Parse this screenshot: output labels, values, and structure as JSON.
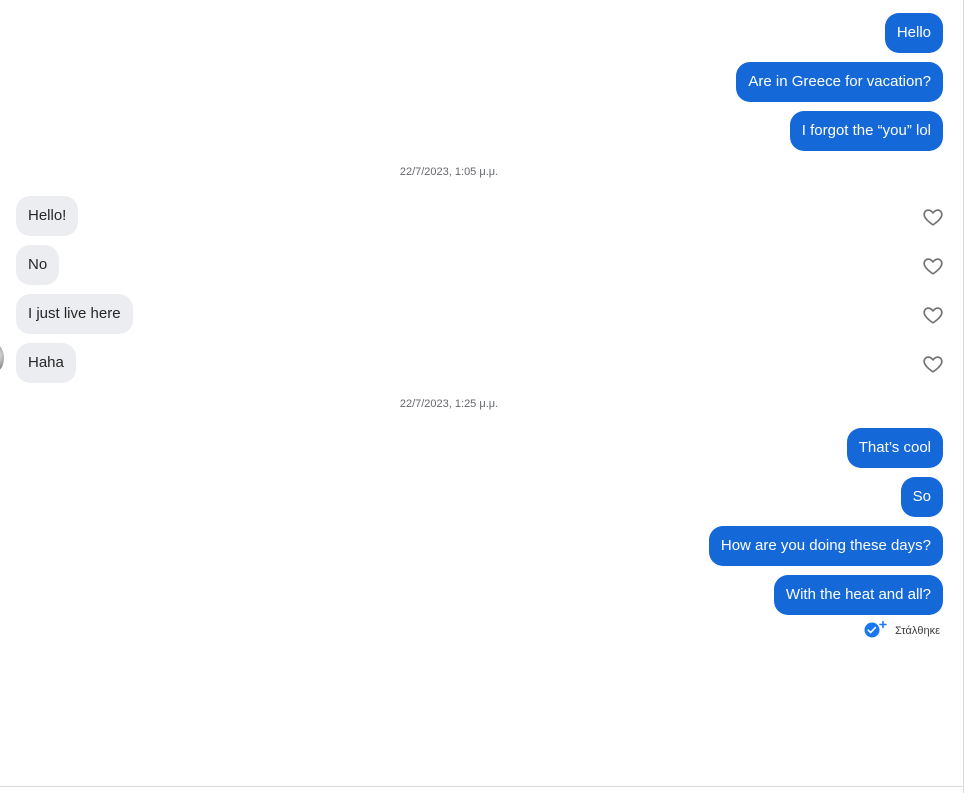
{
  "conversation": {
    "group1": {
      "messages": [
        "Hello",
        "Are in Greece for vacation?",
        "I forgot the “you” lol"
      ]
    },
    "timestamp1": "22/7/2023, 1:05 μ.μ.",
    "group2": {
      "messages": [
        "Hello!",
        "No",
        "I just live here",
        "Haha"
      ]
    },
    "timestamp2": "22/7/2023, 1:25 μ.μ.",
    "group3": {
      "messages": [
        "That’s cool",
        "So",
        "How are you doing these days?",
        "With the heat and all?"
      ]
    },
    "status": {
      "label": "Στάλθηκε",
      "icon": "sent-check-icon"
    }
  },
  "icons": {
    "like": "heart-outline-icon",
    "avatar": "avatar"
  },
  "colors": {
    "outgoing_bubble": "#1468d8",
    "incoming_bubble": "#ebedf0",
    "timestamp_text": "#65676b"
  }
}
